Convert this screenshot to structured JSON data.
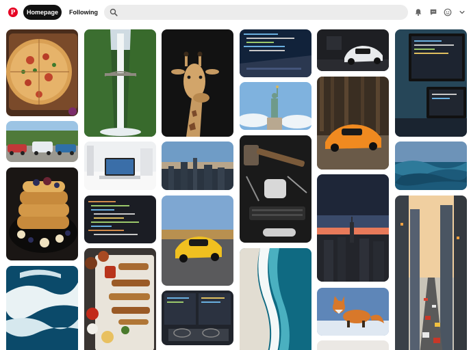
{
  "header": {
    "logo_letter": "P",
    "tab_home_label": "Homepage",
    "tab_following_label": "Following",
    "search_placeholder": "",
    "icons": [
      "pinterest-logo",
      "search-icon",
      "bell-icon",
      "chat-icon",
      "avatar-icon",
      "chevron-down-icon"
    ],
    "brand_color": "#e60023"
  },
  "feed": {
    "pins": [
      {
        "subject": "pizza"
      },
      {
        "subject": "vintage cars on street"
      },
      {
        "subject": "french toast with berries"
      },
      {
        "subject": "ocean waves aerial"
      },
      {
        "subject": "waterfall with bridge"
      },
      {
        "subject": "desk with laptop"
      },
      {
        "subject": "code on screen"
      },
      {
        "subject": "grilled food platter"
      },
      {
        "subject": "giraffe"
      },
      {
        "subject": "city skyline at dusk"
      },
      {
        "subject": "yellow sports car"
      },
      {
        "subject": "laptop with code"
      },
      {
        "subject": "keyboard code closeup"
      },
      {
        "subject": "statue of liberty"
      },
      {
        "subject": "tools on dark desk"
      },
      {
        "subject": "aerial beach waves"
      },
      {
        "subject": "white sports car at night"
      },
      {
        "subject": "orange sports car in forest"
      },
      {
        "subject": "city skyline at sunset"
      },
      {
        "subject": "fox in snow"
      },
      {
        "subject": "computer monitors"
      },
      {
        "subject": "ocean wave"
      },
      {
        "subject": "city street traffic"
      }
    ]
  }
}
